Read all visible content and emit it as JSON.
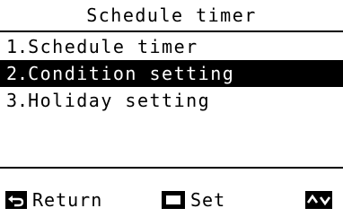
{
  "screen": {
    "title": "Schedule timer",
    "menu_items": [
      {
        "number": "1.",
        "label": "Schedule timer",
        "selected": false
      },
      {
        "number": "2.",
        "label": "Condition setting",
        "selected": true
      },
      {
        "number": "3.",
        "label": "Holiday setting",
        "selected": false
      }
    ]
  },
  "footer": {
    "return_label": "Return",
    "return_icon": "return-arrow-icon",
    "set_label": "Set",
    "set_icon": "square-button-icon",
    "updown_icon": "up-down-arrows-icon"
  },
  "colors": {
    "background": "#ffffff",
    "foreground": "#000000",
    "highlight_bg": "#000000",
    "highlight_fg": "#ffffff"
  }
}
